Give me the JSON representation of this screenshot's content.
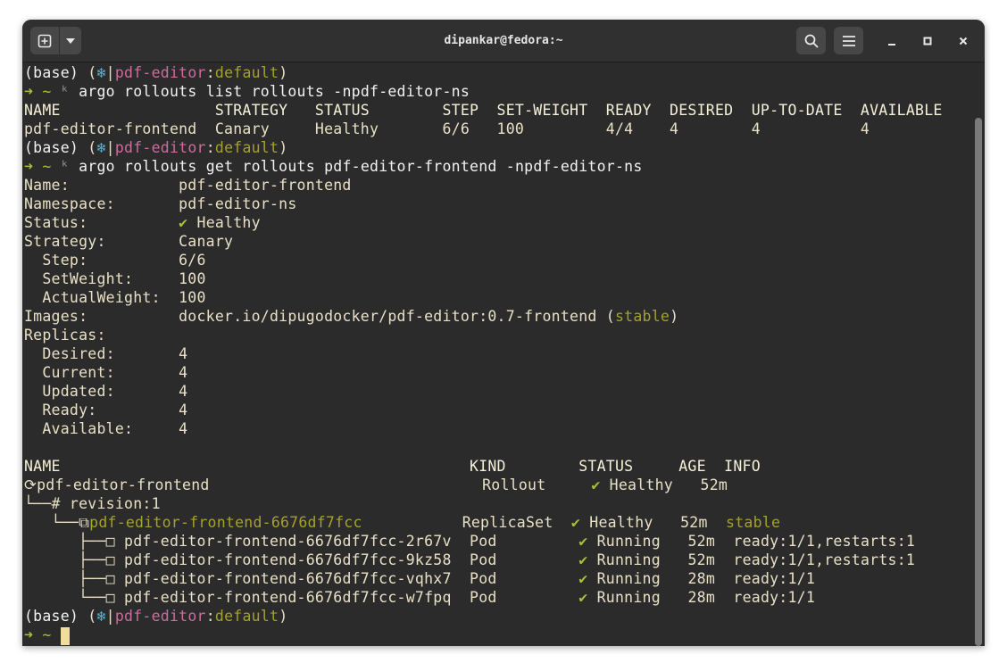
{
  "window": {
    "title": "dipankar@fedora:~"
  },
  "icons": {
    "new_tab": "plus-in-square-icon",
    "menu_arrow": "chevron-down-icon",
    "search": "search-icon",
    "hamburger": "hamburger-menu-icon",
    "minimize": "minimize-icon",
    "maximize": "maximize-icon",
    "close": "close-icon"
  },
  "prompt": {
    "base": "(base)",
    "open_paren": " (",
    "k8s_icon": "❄",
    "sep": "|",
    "context": "pdf-editor",
    "colon": ":",
    "namespace": "default",
    "close_paren": ")",
    "arrow": "➜",
    "dir": "~",
    "k_glyph": "ᵏ"
  },
  "commands": {
    "cmd1": "argo rollouts list rollouts -npdf-editor-ns",
    "cmd2": "argo rollouts get rollouts pdf-editor-frontend -npdf-editor-ns"
  },
  "list_table": {
    "header": "NAME                 STRATEGY   STATUS        STEP  SET-WEIGHT  READY  DESIRED  UP-TO-DATE  AVAILABLE",
    "row": "pdf-editor-frontend  Canary     Healthy       6/6   100         4/4    4        4           4"
  },
  "details": {
    "name_line": "Name:            pdf-editor-frontend",
    "ns_line": "Namespace:       pdf-editor-ns",
    "status_label": "Status:          ",
    "status_check": "✔",
    "status_value": " Healthy",
    "strategy_line": "Strategy:        Canary",
    "step_line": "  Step:          6/6",
    "setweight_line": "  SetWeight:     100",
    "actualweight_line": "  ActualWeight:  100",
    "images_label": "Images:          docker.io/dipugodocker/pdf-editor:0.7-frontend (",
    "images_tag": "stable",
    "images_close": ")",
    "replicas_line": "Replicas:",
    "desired_line": "  Desired:       4",
    "current_line": "  Current:       4",
    "updated_line": "  Updated:       4",
    "ready_line": "  Ready:         4",
    "available_line": "  Available:     4"
  },
  "tree": {
    "header": "NAME                                             KIND        STATUS     AGE  INFO",
    "rollout": {
      "prefix": "⟳",
      "name": "pdf-editor-frontend                              ",
      "kind": "Rollout     ",
      "check": "✔",
      "status": " Healthy   ",
      "age": "52m"
    },
    "revision": "└──# revision:1",
    "replicaset": {
      "prefix": "   └──⧉",
      "name": "pdf-editor-frontend-6676df7fcc",
      "pad": "           ",
      "kind": "ReplicaSet  ",
      "check": "✔",
      "status": " Healthy   ",
      "age": "52m  ",
      "info": "stable"
    },
    "pods": [
      {
        "prefix": "      ├──□ ",
        "name": "pdf-editor-frontend-6676df7fcc-2r67v  ",
        "kind": "Pod         ",
        "check": "✔",
        "status": " Running   ",
        "age": "52m  ",
        "info": "ready:1/1,restarts:1"
      },
      {
        "prefix": "      ├──□ ",
        "name": "pdf-editor-frontend-6676df7fcc-9kz58  ",
        "kind": "Pod         ",
        "check": "✔",
        "status": " Running   ",
        "age": "52m  ",
        "info": "ready:1/1,restarts:1"
      },
      {
        "prefix": "      ├──□ ",
        "name": "pdf-editor-frontend-6676df7fcc-vqhx7  ",
        "kind": "Pod         ",
        "check": "✔",
        "status": " Running   ",
        "age": "28m  ",
        "info": "ready:1/1"
      },
      {
        "prefix": "      └──□ ",
        "name": "pdf-editor-frontend-6676df7fcc-w7fpq  ",
        "kind": "Pod         ",
        "check": "✔",
        "status": " Running   ",
        "age": "28m  ",
        "info": "ready:1/1"
      }
    ]
  }
}
